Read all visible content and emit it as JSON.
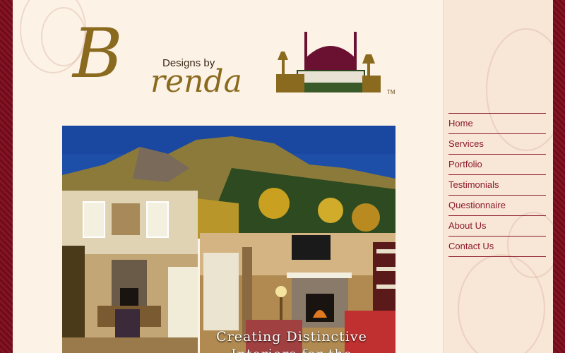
{
  "logo": {
    "script_letter": "B",
    "designs_by": "Designs by",
    "name": "renda",
    "trademark": "TM"
  },
  "hero": {
    "caption_line1": "Creating Distinctive",
    "caption_line2": "Interiors for the"
  },
  "nav": {
    "items": [
      {
        "label": "Home"
      },
      {
        "label": "Services"
      },
      {
        "label": "Portfolio"
      },
      {
        "label": "Testimonials"
      },
      {
        "label": "Questionnaire"
      },
      {
        "label": "About Us"
      },
      {
        "label": "Contact Us"
      }
    ]
  },
  "colors": {
    "background": "#7a0f1f",
    "content": "#fcf2e6",
    "sidebar": "#f8e6d6",
    "nav_link": "#8b1a2a",
    "logo_gold": "#8a6a1e"
  }
}
